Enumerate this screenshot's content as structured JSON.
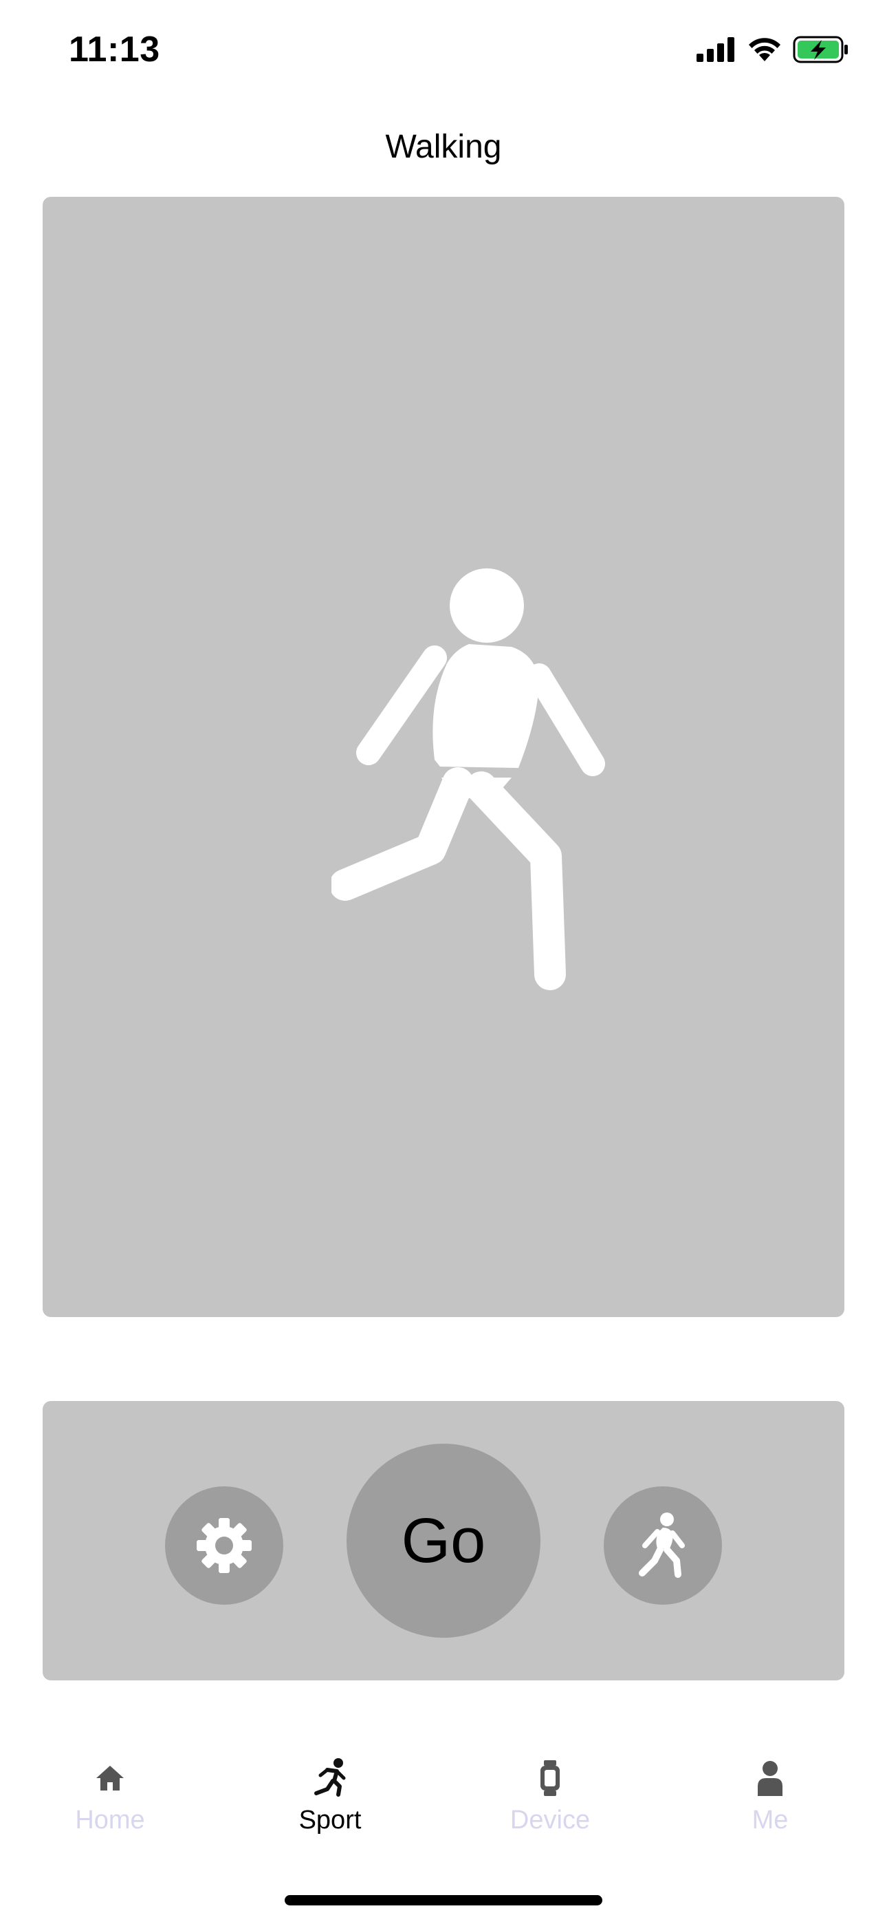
{
  "status_bar": {
    "time": "11:13",
    "icons": [
      "cellular-signal-icon",
      "wifi-icon",
      "battery-charging-icon"
    ],
    "battery_color": "#34c759"
  },
  "header": {
    "title": "Walking"
  },
  "hero": {
    "icon": "walking-figure-icon",
    "background": "#c4c4c4"
  },
  "controls": {
    "settings_icon": "gear-icon",
    "go_label": "Go",
    "mode_icon": "walking-icon",
    "button_color": "#9e9e9e"
  },
  "tab_bar": {
    "items": [
      {
        "label": "Home",
        "icon": "home-icon",
        "active": false
      },
      {
        "label": "Sport",
        "icon": "running-icon",
        "active": true
      },
      {
        "label": "Device",
        "icon": "watch-icon",
        "active": false
      },
      {
        "label": "Me",
        "icon": "person-icon",
        "active": false
      }
    ],
    "inactive_color": "#d8d6ee",
    "active_color": "#000000"
  }
}
